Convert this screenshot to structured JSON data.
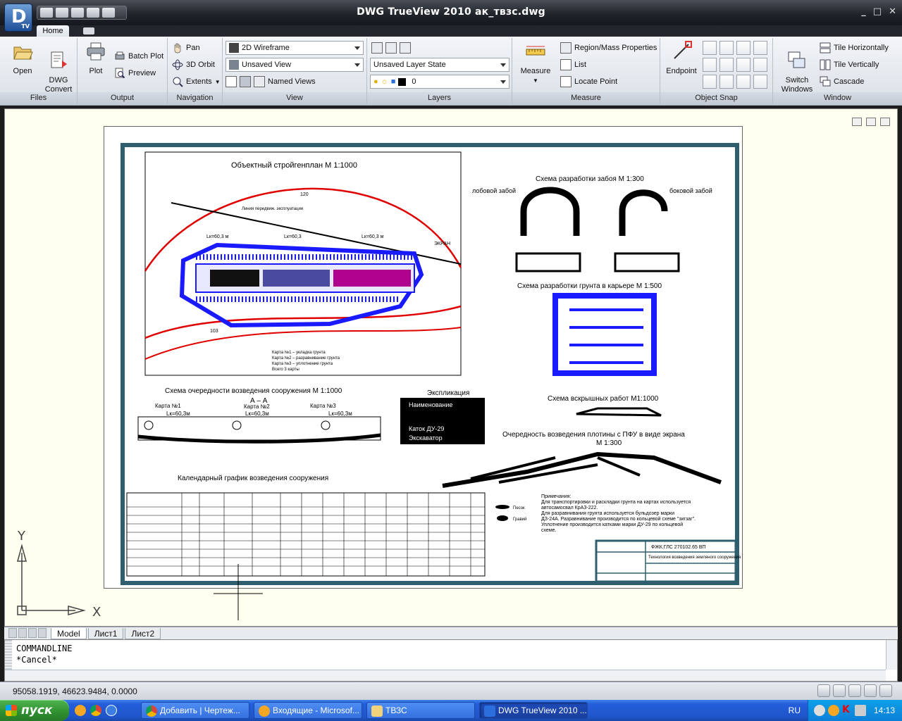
{
  "window": {
    "title": "DWG TrueView 2010    ак_твзс.dwg",
    "logo_letter": "D",
    "logo_sub": "TV",
    "controls": [
      "_",
      "□",
      "✕"
    ]
  },
  "ribbon": {
    "tab": "Home",
    "files": {
      "title": "Files",
      "open": "Open",
      "dwg_convert": "DWG\nConvert"
    },
    "output": {
      "title": "Output",
      "plot": "Plot",
      "batch_plot": "Batch Plot",
      "preview": "Preview"
    },
    "navigation": {
      "title": "Navigation",
      "pan": "Pan",
      "orbit": "3D Orbit",
      "extents": "Extents"
    },
    "view": {
      "title": "View",
      "visual_style": "2D Wireframe",
      "saved_view": "Unsaved View",
      "named_views": "Named Views"
    },
    "layers": {
      "title": "Layers",
      "layer_state": "Unsaved Layer State",
      "current_layer": "0"
    },
    "measure": {
      "title": "Measure",
      "measure": "Measure",
      "region_mass": "Region/Mass Properties",
      "list": "List",
      "locate_point": "Locate Point"
    },
    "object_snap": {
      "title": "Object Snap",
      "endpoint": "Endpoint"
    },
    "window_panel": {
      "title": "Window",
      "switch_windows": "Switch\nWindows",
      "tile_h": "Tile Horizontally",
      "tile_v": "Tile Vertically",
      "cascade": "Cascade"
    }
  },
  "drawing": {
    "plan_title": "Объектный стройгенплан М 1:1000",
    "plan_label_road": "Линия передвиж. эксплуатации",
    "plan_contour_top": "120",
    "plan_contour_bottom": "103",
    "plan_lk1": "Lк=60,3 м",
    "plan_lk2": "Lк=60,3",
    "plan_lk3": "Lк=60,3 м",
    "plan_screen": "ЭКРАН",
    "plan_legend": [
      "Карта №1 – укладка грунта",
      "Карта №2 – разравнивание грунта",
      "Карта №3 – уплотнение грунта",
      "Всего 3 карты"
    ],
    "face_title": "Схема разработки забоя М 1:300",
    "face_front": "лобовой забой",
    "face_side": "боковой забой",
    "quarry_title": "Схема разработки грунта в карьере М 1:500",
    "seq_title": "Схема очередности возведения сооружения М 1:1000",
    "seq_section": "А – А",
    "seq_map1": "Карта №1",
    "seq_map2": "Карта №2",
    "seq_map3": "Карта №3",
    "seq_lk": "Lк=60,3м",
    "expl_title": "Экспликация",
    "expl_rows": [
      "Наименование",
      "",
      "",
      "Каток ДУ-29",
      "Экскаватор"
    ],
    "strip_title": "Схема вскрышных работ М1:1000",
    "dam_title": "Очередность возведения плотины с ПФУ в виде экрана",
    "dam_scale": "М 1:300",
    "calendar_title": "Календарный график возведения сооружения",
    "notes": [
      "Примечания:",
      "Для транспортировки и раскладки грунта на картах используется",
      "автосамосвал КрАЗ-222.",
      "Для разравнивания грунта используется бульдозер марки",
      "ДЗ-24А. Разравнивание производится по кольцевой схеме \"зигзаг\".",
      "Уплотнение производится катками марки ДУ-29 по кольцевой",
      "схеме."
    ],
    "legend_sand": "Песок",
    "legend_gravel": "Гравий",
    "stamp_code": "ФЖК.ГЛС 270102.65 ВП",
    "stamp_name": "Технология возведения земляного сооружения"
  },
  "ucs": {
    "y": "Y",
    "x": "X"
  },
  "layout_tabs": [
    "Model",
    "Лист1",
    "Лист2"
  ],
  "command": {
    "line1": "COMMANDLINE",
    "line2": "*Cancel*"
  },
  "status": {
    "coords": "95058.1919, 46623.9484, 0.0000"
  },
  "taskbar": {
    "start": "пуск",
    "tasks": [
      "Добавить | Чертеж...",
      "Входящие - Microsof...",
      "ТВЗС",
      "DWG TrueView 2010 ..."
    ],
    "lang": "RU",
    "clock": "14:13"
  },
  "colors": {
    "frame": "#2f5f6e",
    "blue": "#1a1aff",
    "red": "#e00000",
    "magenta": "#b0008e"
  }
}
